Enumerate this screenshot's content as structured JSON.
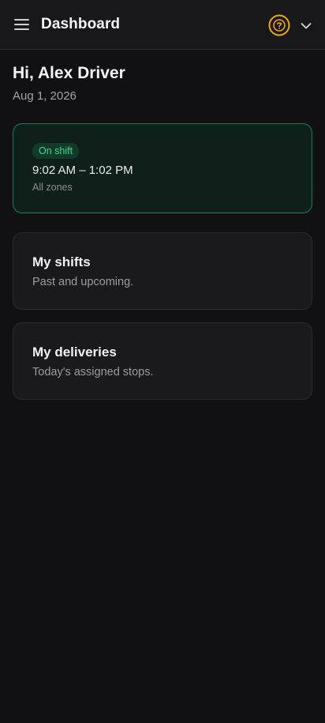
{
  "header": {
    "title": "Dashboard",
    "menu_icon": "hamburger-menu-icon",
    "help_icon": "question-circle-icon",
    "chevron_icon": "chevron-down-icon",
    "accent_color": "#f0a800"
  },
  "greeting": {
    "text": "Hi, Alex Driver",
    "date": "Aug 1, 2026"
  },
  "shift": {
    "status": "On shift",
    "time": "9:02 AM – 1:02 PM",
    "zones": "All zones",
    "status_color": "#38d98a"
  },
  "cards": [
    {
      "title": "My shifts",
      "subtitle": "Past and upcoming."
    },
    {
      "title": "My deliveries",
      "subtitle": "Today's assigned stops."
    }
  ]
}
